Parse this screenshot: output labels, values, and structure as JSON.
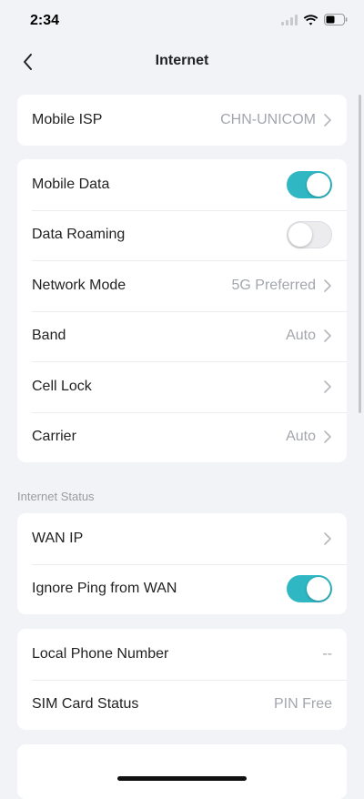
{
  "status_bar": {
    "time": "2:34"
  },
  "nav": {
    "title": "Internet"
  },
  "isp_card": {
    "label": "Mobile ISP",
    "value": "CHN-UNICOM"
  },
  "settings": {
    "mobile_data": {
      "label": "Mobile Data",
      "enabled": true
    },
    "data_roaming": {
      "label": "Data Roaming",
      "enabled": false
    },
    "network_mode": {
      "label": "Network Mode",
      "value": "5G Preferred"
    },
    "band": {
      "label": "Band",
      "value": "Auto"
    },
    "cell_lock": {
      "label": "Cell Lock",
      "value": ""
    },
    "carrier": {
      "label": "Carrier",
      "value": "Auto"
    }
  },
  "internet_status": {
    "header": "Internet Status",
    "wan_ip": {
      "label": "WAN IP"
    },
    "ignore_ping": {
      "label": "Ignore Ping from WAN",
      "enabled": true
    }
  },
  "sim_info": {
    "phone_number": {
      "label": "Local Phone Number",
      "value": "--"
    },
    "sim_status": {
      "label": "SIM Card Status",
      "value": "PIN Free"
    }
  },
  "colors": {
    "accent": "#2fb8c4",
    "background": "#f2f3f7",
    "card": "#ffffff",
    "secondary_text": "#a3a6ad"
  }
}
